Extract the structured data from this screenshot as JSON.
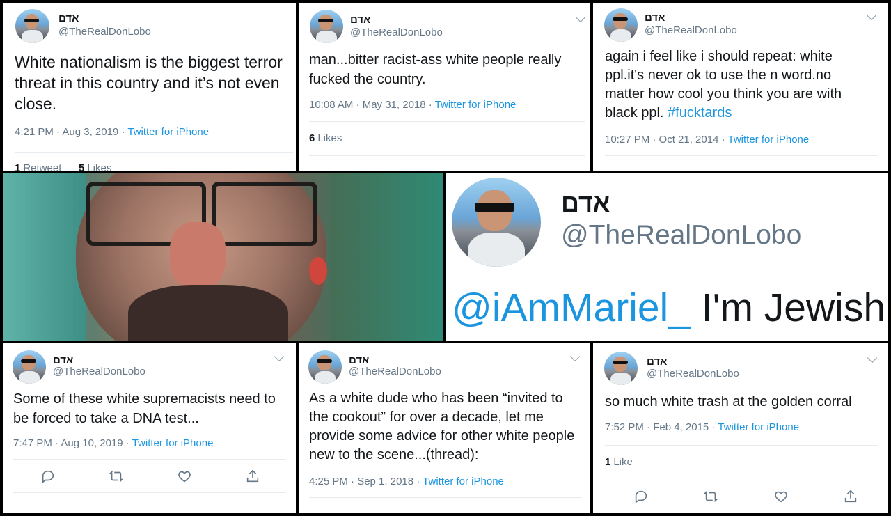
{
  "user": {
    "display_name": "אדם",
    "handle": "@TheRealDonLobo"
  },
  "tweets": [
    {
      "text": "White nationalism is the biggest terror threat in this country and it’s not even close.",
      "time": "4:21 PM · Aug 3, 2019",
      "source": "Twitter for iPhone",
      "retweets": "1",
      "retweets_label": "Retweet",
      "likes": "5",
      "likes_label": "Likes"
    },
    {
      "text": "man...bitter racist-ass white people really fucked the country.",
      "time": "10:08 AM · May 31, 2018",
      "source": "Twitter for iPhone",
      "likes": "6",
      "likes_label": "Likes"
    },
    {
      "text": "again i feel like i should repeat: white ppl.it's never ok to use the n word.no matter how cool you think you are with black ppl.",
      "hashtag": "#fucktards",
      "time": "10:27 PM · Oct 21, 2014",
      "source": "Twitter for iPhone"
    },
    {
      "text": "Some of these white supremacists need to be forced to take a DNA test...",
      "time": "7:47 PM · Aug 10, 2019",
      "source": "Twitter for iPhone"
    },
    {
      "text": "As a white dude who has been “invited to the cookout” for over a decade, let me provide some advice for other white people new to the scene...(thread):",
      "time": "4:25 PM · Sep 1, 2018",
      "source": "Twitter for iPhone"
    },
    {
      "text": "so much white trash at the golden corral",
      "time": "7:52 PM · Feb 4, 2015",
      "source": "Twitter for iPhone",
      "likes": "1",
      "likes_label": "Like"
    }
  ],
  "reply": {
    "mention": "@iAmMariel_",
    "text": "I'm Jewish"
  },
  "icons": [
    "reply-icon",
    "retweet-icon",
    "like-icon",
    "share-icon",
    "chevron-down-icon"
  ],
  "colors": {
    "link": "#1b95e0",
    "muted": "#657786",
    "text": "#14171a"
  }
}
